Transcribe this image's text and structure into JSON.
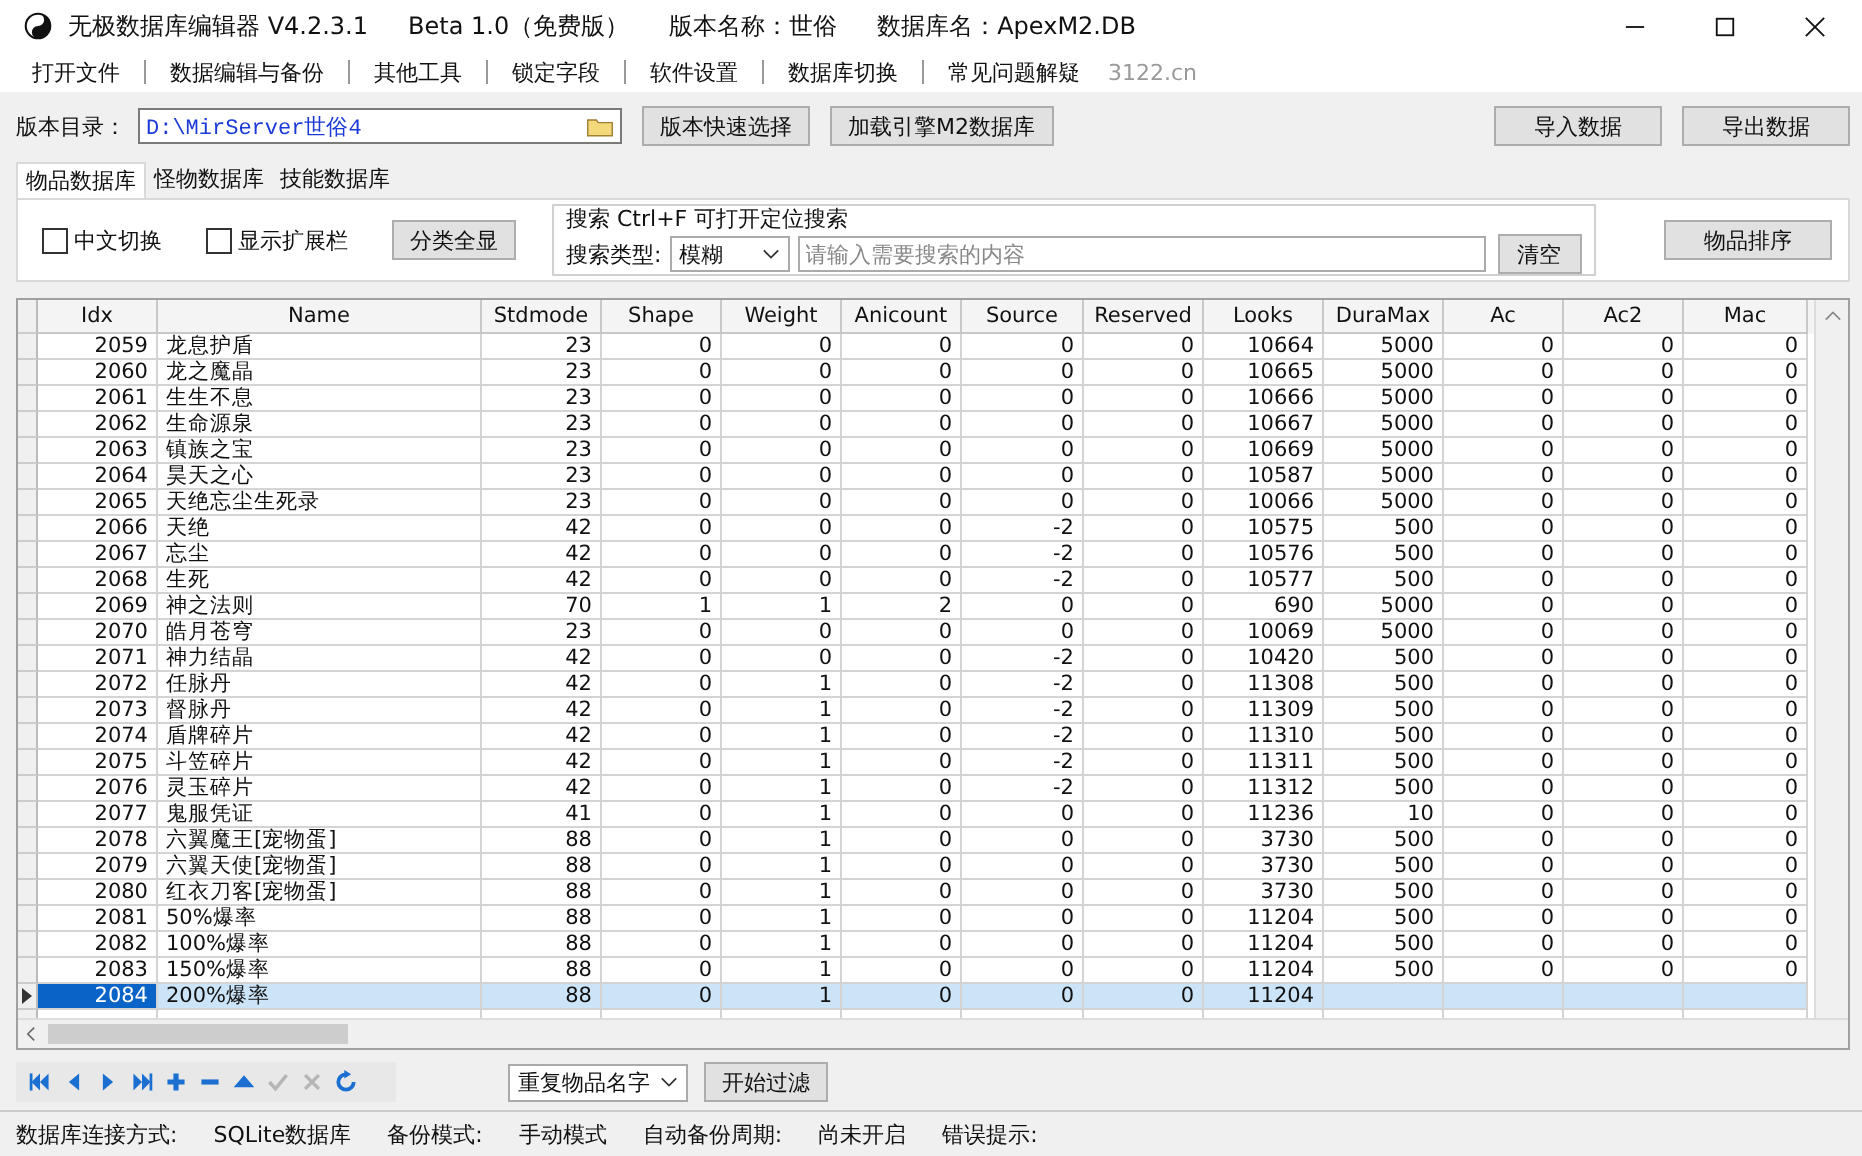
{
  "window": {
    "title_parts": [
      "无极数据库编辑器 V4.2.3.1",
      "Beta 1.0（免费版）",
      "版本名称：世俗",
      "数据库名：ApexM2.DB"
    ]
  },
  "menu": [
    "打开文件",
    "数据编辑与备份",
    "其他工具",
    "锁定字段",
    "软件设置",
    "数据库切换",
    "常见问题解疑"
  ],
  "menu_note": "3122.cn",
  "version_dir": {
    "label": "版本目录：",
    "value": "D:\\MirServer世俗4",
    "buttons": [
      "版本快速选择",
      "加载引擎M2数据库"
    ]
  },
  "data_buttons": [
    "导入数据",
    "导出数据"
  ],
  "tabs": [
    {
      "label": "物品数据库",
      "selected": true
    },
    {
      "label": "怪物数据库",
      "selected": false
    },
    {
      "label": "技能数据库",
      "selected": false
    }
  ],
  "options": [
    {
      "label": "中文切换",
      "checked": false
    },
    {
      "label": "显示扩展栏",
      "checked": false
    }
  ],
  "show_all_button": "分类全显",
  "search": {
    "title": "搜索  Ctrl+F 可打开定位搜索",
    "type_label": "搜索类型:",
    "type_value": "模糊",
    "placeholder": "请输入需要搜索的内容",
    "clear_button": "清空"
  },
  "sort_button": "物品排序",
  "table": {
    "columns": [
      "Idx",
      "Name",
      "Stdmode",
      "Shape",
      "Weight",
      "Anicount",
      "Source",
      "Reserved",
      "Looks",
      "DuraMax",
      "Ac",
      "Ac2",
      "Mac"
    ],
    "rows": [
      {
        "selected": false,
        "cells": [
          "2059",
          "龙息护盾",
          "23",
          "0",
          "0",
          "0",
          "0",
          "0",
          "10664",
          "5000",
          "0",
          "0",
          "0"
        ]
      },
      {
        "selected": false,
        "cells": [
          "2060",
          "龙之魔晶",
          "23",
          "0",
          "0",
          "0",
          "0",
          "0",
          "10665",
          "5000",
          "0",
          "0",
          "0"
        ]
      },
      {
        "selected": false,
        "cells": [
          "2061",
          "生生不息",
          "23",
          "0",
          "0",
          "0",
          "0",
          "0",
          "10666",
          "5000",
          "0",
          "0",
          "0"
        ]
      },
      {
        "selected": false,
        "cells": [
          "2062",
          "生命源泉",
          "23",
          "0",
          "0",
          "0",
          "0",
          "0",
          "10667",
          "5000",
          "0",
          "0",
          "0"
        ]
      },
      {
        "selected": false,
        "cells": [
          "2063",
          "镇族之宝",
          "23",
          "0",
          "0",
          "0",
          "0",
          "0",
          "10669",
          "5000",
          "0",
          "0",
          "0"
        ]
      },
      {
        "selected": false,
        "cells": [
          "2064",
          "昊天之心",
          "23",
          "0",
          "0",
          "0",
          "0",
          "0",
          "10587",
          "5000",
          "0",
          "0",
          "0"
        ]
      },
      {
        "selected": false,
        "cells": [
          "2065",
          "天绝忘尘生死录",
          "23",
          "0",
          "0",
          "0",
          "0",
          "0",
          "10066",
          "5000",
          "0",
          "0",
          "0"
        ]
      },
      {
        "selected": false,
        "cells": [
          "2066",
          "天绝",
          "42",
          "0",
          "0",
          "0",
          "-2",
          "0",
          "10575",
          "500",
          "0",
          "0",
          "0"
        ]
      },
      {
        "selected": false,
        "cells": [
          "2067",
          "忘尘",
          "42",
          "0",
          "0",
          "0",
          "-2",
          "0",
          "10576",
          "500",
          "0",
          "0",
          "0"
        ]
      },
      {
        "selected": false,
        "cells": [
          "2068",
          "生死",
          "42",
          "0",
          "0",
          "0",
          "-2",
          "0",
          "10577",
          "500",
          "0",
          "0",
          "0"
        ]
      },
      {
        "selected": false,
        "cells": [
          "2069",
          "神之法则",
          "70",
          "1",
          "1",
          "2",
          "0",
          "0",
          "690",
          "5000",
          "0",
          "0",
          "0"
        ]
      },
      {
        "selected": false,
        "cells": [
          "2070",
          "皓月苍穹",
          "23",
          "0",
          "0",
          "0",
          "0",
          "0",
          "10069",
          "5000",
          "0",
          "0",
          "0"
        ]
      },
      {
        "selected": false,
        "cells": [
          "2071",
          "神力结晶",
          "42",
          "0",
          "0",
          "0",
          "-2",
          "0",
          "10420",
          "500",
          "0",
          "0",
          "0"
        ]
      },
      {
        "selected": false,
        "cells": [
          "2072",
          "任脉丹",
          "42",
          "0",
          "1",
          "0",
          "-2",
          "0",
          "11308",
          "500",
          "0",
          "0",
          "0"
        ]
      },
      {
        "selected": false,
        "cells": [
          "2073",
          "督脉丹",
          "42",
          "0",
          "1",
          "0",
          "-2",
          "0",
          "11309",
          "500",
          "0",
          "0",
          "0"
        ]
      },
      {
        "selected": false,
        "cells": [
          "2074",
          "盾牌碎片",
          "42",
          "0",
          "1",
          "0",
          "-2",
          "0",
          "11310",
          "500",
          "0",
          "0",
          "0"
        ]
      },
      {
        "selected": false,
        "cells": [
          "2075",
          "斗笠碎片",
          "42",
          "0",
          "1",
          "0",
          "-2",
          "0",
          "11311",
          "500",
          "0",
          "0",
          "0"
        ]
      },
      {
        "selected": false,
        "cells": [
          "2076",
          "灵玉碎片",
          "42",
          "0",
          "1",
          "0",
          "-2",
          "0",
          "11312",
          "500",
          "0",
          "0",
          "0"
        ]
      },
      {
        "selected": false,
        "cells": [
          "2077",
          "鬼服凭证",
          "41",
          "0",
          "1",
          "0",
          "0",
          "0",
          "11236",
          "10",
          "0",
          "0",
          "0"
        ]
      },
      {
        "selected": false,
        "cells": [
          "2078",
          "六翼魔王[宠物蛋]",
          "88",
          "0",
          "1",
          "0",
          "0",
          "0",
          "3730",
          "500",
          "0",
          "0",
          "0"
        ]
      },
      {
        "selected": false,
        "cells": [
          "2079",
          "六翼天使[宠物蛋]",
          "88",
          "0",
          "1",
          "0",
          "0",
          "0",
          "3730",
          "500",
          "0",
          "0",
          "0"
        ]
      },
      {
        "selected": false,
        "cells": [
          "2080",
          "红衣刀客[宠物蛋]",
          "88",
          "0",
          "1",
          "0",
          "0",
          "0",
          "3730",
          "500",
          "0",
          "0",
          "0"
        ]
      },
      {
        "selected": false,
        "cells": [
          "2081",
          "50%爆率",
          "88",
          "0",
          "1",
          "0",
          "0",
          "0",
          "11204",
          "500",
          "0",
          "0",
          "0"
        ]
      },
      {
        "selected": false,
        "cells": [
          "2082",
          "100%爆率",
          "88",
          "0",
          "1",
          "0",
          "0",
          "0",
          "11204",
          "500",
          "0",
          "0",
          "0"
        ]
      },
      {
        "selected": false,
        "cells": [
          "2083",
          "150%爆率",
          "88",
          "0",
          "1",
          "0",
          "0",
          "0",
          "11204",
          "500",
          "0",
          "0",
          "0"
        ]
      },
      {
        "selected": true,
        "cells": [
          "2084",
          "200%爆率",
          "88",
          "0",
          "1",
          "0",
          "0",
          "0",
          "11204"
        ]
      }
    ]
  },
  "filter": {
    "value": "重复物品名字",
    "button": "开始过滤"
  },
  "status_bar": [
    "数据库连接方式:",
    "SQLite数据库",
    "备份模式:",
    "手动模式",
    "自动备份周期:",
    "尚未开启",
    "错误提示:"
  ]
}
